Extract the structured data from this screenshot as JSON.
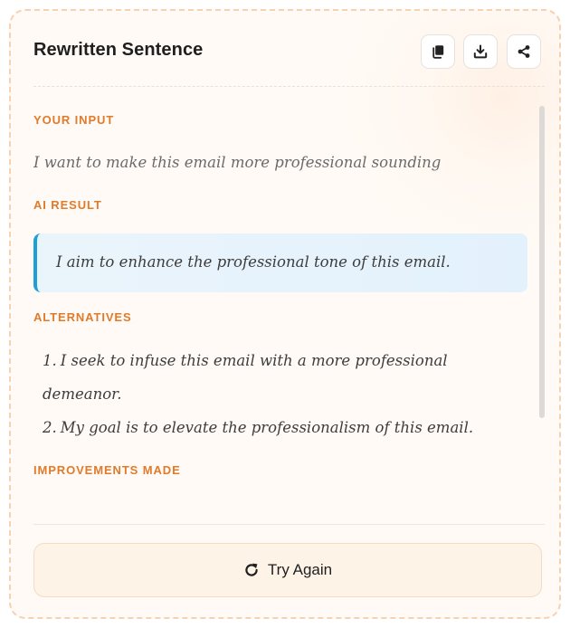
{
  "header": {
    "title": "Rewritten Sentence",
    "actions": [
      {
        "icon": "copy-icon"
      },
      {
        "icon": "download-icon"
      },
      {
        "icon": "share-icon"
      }
    ]
  },
  "sections": {
    "input": {
      "label": "YOUR INPUT",
      "text": "I want to make this email more professional sounding"
    },
    "result": {
      "label": "AI RESULT",
      "text": "I aim to enhance the professional tone of this email."
    },
    "alternatives": {
      "label": "ALTERNATIVES",
      "items": [
        {
          "number": "1.",
          "text": "I seek to infuse this email with a more professional demeanor."
        },
        {
          "number": "2.",
          "text": "My goal is to elevate the professionalism of this email."
        }
      ]
    },
    "improvements": {
      "label": "IMPROVEMENTS MADE"
    }
  },
  "footer": {
    "try_again_label": "Try Again",
    "try_again_icon": "refresh-icon"
  },
  "colors": {
    "accent": "#e07b2b",
    "result_border": "#1e9fd8",
    "result_bg": "#e3f1fd",
    "card_border": "#f5d2b3",
    "button_bg": "#fdf3e6"
  }
}
